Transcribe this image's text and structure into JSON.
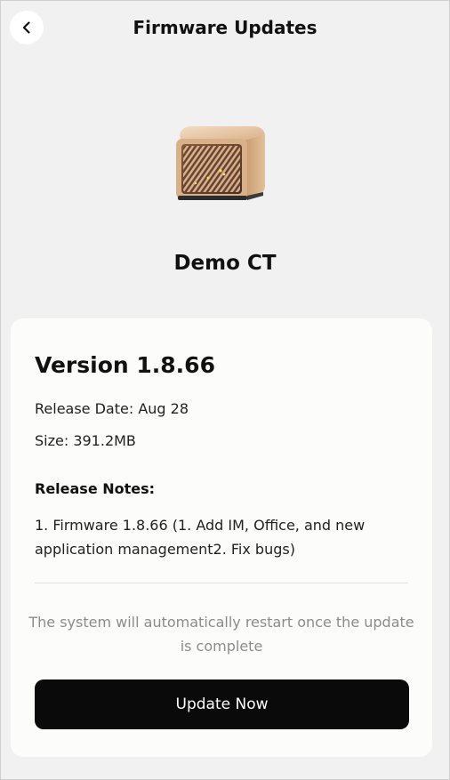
{
  "header": {
    "title": "Firmware Updates",
    "back_icon": "chevron-left-icon"
  },
  "device": {
    "name": "Demo CT",
    "image": "nas-device-image"
  },
  "update": {
    "version": "Version 1.8.66",
    "release_date": "Release Date: Aug 28",
    "size": "Size: 391.2MB",
    "notes_heading": "Release Notes:",
    "notes_body": "1. Firmware 1.8.66 (1. Add IM, Office, and new application management2. Fix bugs)",
    "restart_note": "The system will automatically restart once the update is complete",
    "button_label": "Update Now"
  },
  "colors": {
    "background": "#f1f1f1",
    "card": "#fcfcfa",
    "button": "#0a0a0a",
    "device_gold": "#d9b48f"
  }
}
